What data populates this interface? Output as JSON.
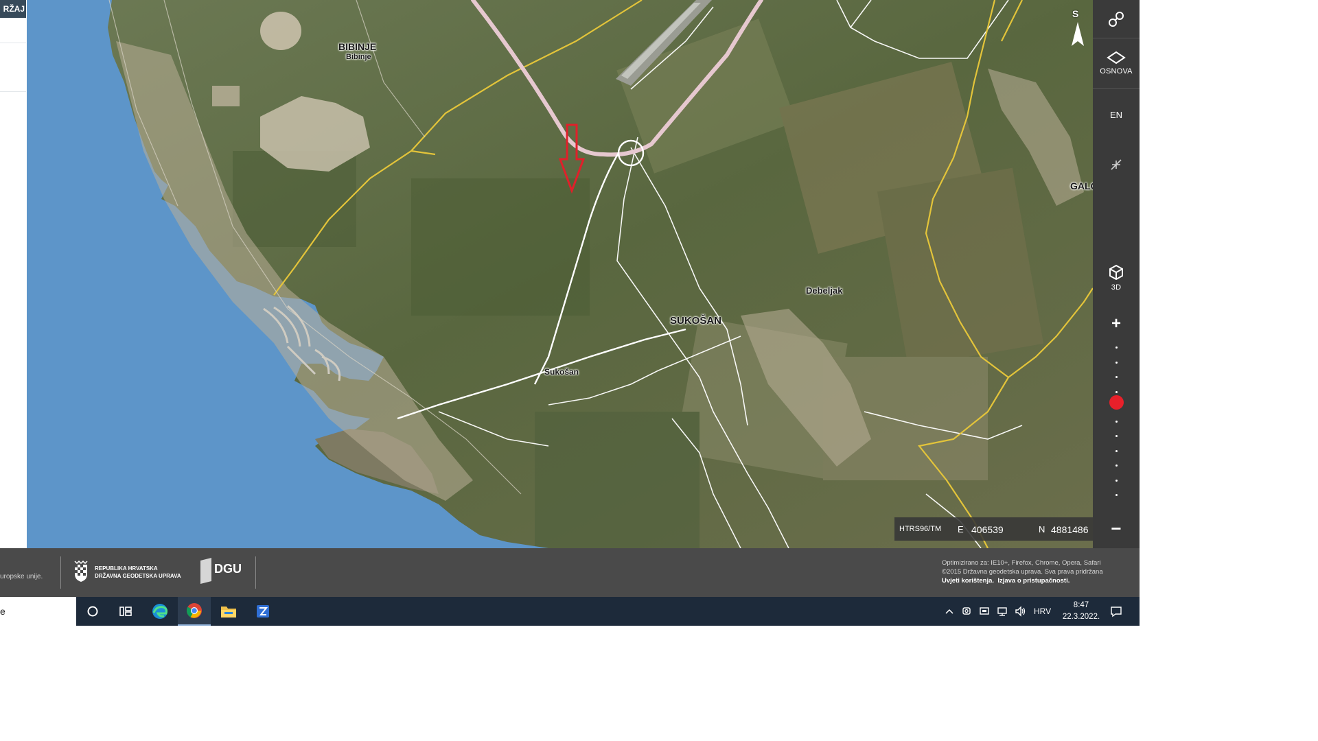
{
  "left_panel": {
    "header_fragment": "RŽAJ"
  },
  "map": {
    "places": [
      {
        "name": "BIBINJE",
        "style": "town"
      },
      {
        "name": "Bibinje",
        "style": "small"
      },
      {
        "name": "SUKOŠAN",
        "style": "town"
      },
      {
        "name": "Sukošan",
        "style": "village"
      },
      {
        "name": "Debeljak",
        "style": "village"
      },
      {
        "name": "GALOVAC",
        "style": "town-partial"
      }
    ],
    "north_label": "S",
    "marker": "red-arrow-down",
    "coords": {
      "projection": "HTRS96/TM",
      "e_label": "E",
      "e_value": "406539",
      "n_label": "N",
      "n_value": "4881486"
    },
    "colors": {
      "sea": "#5d95c9",
      "border_line": "#e3c43a",
      "road": "#e6c8cf",
      "marker": "#e0202a"
    }
  },
  "toolbar": {
    "tools_icon": "tools-icon",
    "layers_label": "OSNOVA",
    "language_label": "EN",
    "collapse_icon": "collapse-icon",
    "view3d_label": "3D",
    "zoom_in": "+",
    "zoom_out": "−",
    "zoom_level_fraction_from_top": 0.37,
    "knob_color": "#e8202a"
  },
  "footer": {
    "eu_text": "uropske unije.",
    "rh_line1": "REPUBLIKA HRVATSKA",
    "rh_line2": "DRŽAVNA GEODETSKA UPRAVA",
    "dgu_logo": "DGU",
    "optimized": "Optimizirano za: IE10+, Firefox, Chrome, Opera, Safari",
    "copyright": "©2015 Državna geodetska uprava. Sva prava pridržana",
    "terms": "Uvjeti korištenja.",
    "accessibility": "Izjava o pristupačnosti."
  },
  "taskbar": {
    "search_fragment": "e",
    "apps": [
      "cortana-icon",
      "task-view-icon",
      "edge-icon",
      "chrome-icon",
      "file-explorer-icon",
      "app-icon"
    ],
    "language": "HRV",
    "time": "8:47",
    "date": "22.3.2022."
  }
}
